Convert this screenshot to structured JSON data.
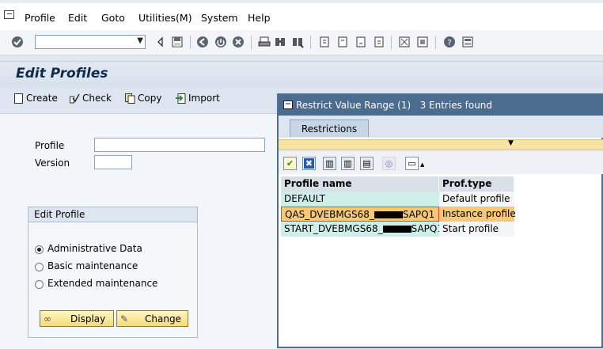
{
  "menu": {
    "items": [
      "Profile",
      "Edit",
      "Goto",
      "Utilities(M)",
      "System",
      "Help"
    ]
  },
  "command_field": {
    "value": ""
  },
  "page": {
    "title": "Edit Profiles"
  },
  "app_toolbar": {
    "create": "Create",
    "check": "Check",
    "copy": "Copy",
    "import": "Import"
  },
  "form": {
    "profile_label": "Profile",
    "profile_value": "",
    "version_label": "Version",
    "version_value": ""
  },
  "edit_group": {
    "title": "Edit Profile",
    "options": [
      "Administrative Data",
      "Basic maintenance",
      "Extended maintenance"
    ],
    "selected_index": 0,
    "display_button": "Display",
    "change_button": "Change"
  },
  "popup": {
    "title": "Restrict Value Range (1)   3 Entries found",
    "tab": "Restrictions",
    "columns": [
      "Profile name",
      "Prof.type"
    ],
    "rows": [
      {
        "name_prefix": "DEFAULT",
        "name_suffix": "",
        "redacted": false,
        "type": "Default profile",
        "selected": false
      },
      {
        "name_prefix": "QAS_DVEBMGS68_",
        "name_suffix": "SAPQ1",
        "redacted": true,
        "type": "Instance profile",
        "selected": true
      },
      {
        "name_prefix": "START_DVEBMGS68_",
        "name_suffix": "SAPQ1",
        "redacted": true,
        "type": "Start profile",
        "selected": false
      }
    ]
  },
  "colors": {
    "title_text": "#102a4a",
    "popup_header": "#4b6b8f",
    "button_yellow": "#f5dc74",
    "selected_row": "#f7c875"
  }
}
